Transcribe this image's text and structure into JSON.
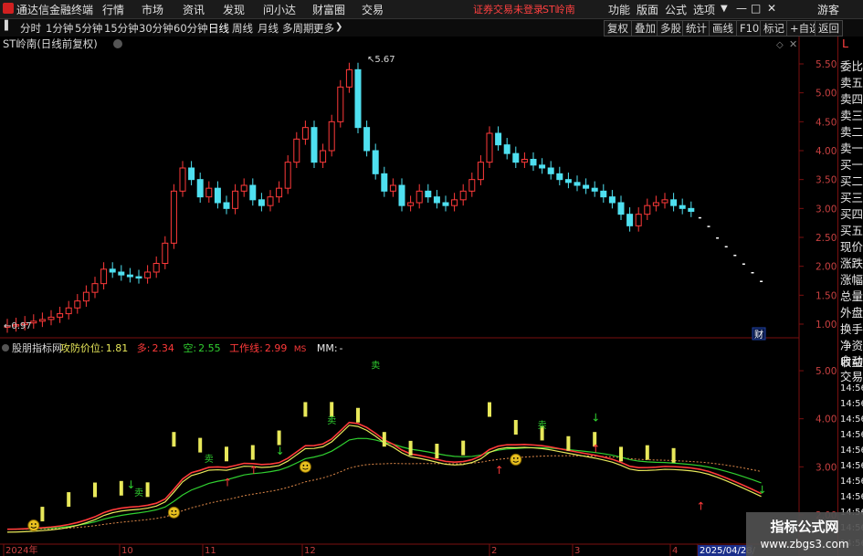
{
  "app": {
    "title": "通达信金融终端",
    "menu": [
      "行情",
      "市场",
      "资讯",
      "发现",
      "问小达",
      "财富圈",
      "交易"
    ],
    "notice": "证券交易未登录",
    "stock_tag": "ST岭南",
    "right_menu": [
      "功能",
      "版面",
      "公式",
      "选项"
    ],
    "guest": "游客"
  },
  "toolbar": {
    "timeframes": [
      "分时",
      "1分钟",
      "5分钟",
      "15分钟",
      "30分钟",
      "60分钟",
      "日线",
      "周线",
      "月线",
      "多周期",
      "更多"
    ],
    "active": "日线",
    "right_buttons": [
      "复权",
      "叠加",
      "多股",
      "统计",
      "画线",
      "F10",
      "标记",
      "+自选",
      "返回"
    ]
  },
  "main_panel": {
    "title": "ST岭南(日线前复权)",
    "price_axis": [
      "5.50",
      "5.00",
      "4.50",
      "4.00",
      "3.50",
      "3.00",
      "2.50",
      "2.00",
      "1.50",
      "1.00"
    ],
    "high_label": "5.67",
    "low_label": "0.97",
    "fin_badge": "财"
  },
  "sub_panel": {
    "name": "股朋指标网",
    "items": [
      {
        "label": "攻防价位:",
        "value": "1.81",
        "color": "#e8e85a"
      },
      {
        "label": "多:",
        "value": "2.34",
        "color": "#ff3a3a"
      },
      {
        "label": "空:",
        "value": "2.55",
        "color": "#30d030"
      },
      {
        "label": "工作线:",
        "value": "2.99",
        "color": "#ff3a3a"
      },
      {
        "label": "MS",
        "value": "",
        "color": "#ff3a3a"
      },
      {
        "label": "MM:",
        "value": "-",
        "color": "#e8e8e8"
      }
    ],
    "axis": [
      "5.00",
      "4.00",
      "3.00",
      "2.00"
    ],
    "sell_label": "卖"
  },
  "dates": [
    {
      "label": "2024年"
    },
    {
      "label": "10"
    },
    {
      "label": "11"
    },
    {
      "label": "12"
    },
    {
      "label": "2"
    },
    {
      "label": "3"
    },
    {
      "label": "4"
    },
    {
      "label": "2025/04/28/"
    }
  ],
  "right_panel": {
    "top_letter": "L",
    "labels": [
      "委比",
      "卖五",
      "卖四",
      "卖三",
      "卖二",
      "卖一",
      "买一",
      "买二",
      "买三",
      "买四",
      "买五",
      "现价",
      "涨跌",
      "涨幅",
      "总量",
      "外盘",
      "换手",
      "净资",
      "收益"
    ],
    "auto": "自动",
    "trade": "交易",
    "times": [
      "14:56",
      "14:56",
      "14:56",
      "14:56",
      "14:56",
      "14:56",
      "14:56",
      "14:56",
      "14:56",
      "14:56",
      "14:56"
    ]
  },
  "watermark": {
    "line1": "指标公式网",
    "line2": "www.zbgs3.com"
  },
  "colors": {
    "up": "#ff3a3a",
    "down": "#4fe0f0",
    "cyan_candle": "#4fe0f0",
    "yellow": "#e8e85a",
    "green": "#30d030",
    "axis": "#c84040"
  },
  "chart_data": {
    "type": "candlestick",
    "title": "ST岭南(日线前复权)",
    "y_range": [
      0.95,
      5.75
    ],
    "series": [
      {
        "name": "close",
        "values": [
          0.97,
          0.99,
          1.02,
          1.05,
          1.08,
          1.12,
          1.18,
          1.28,
          1.4,
          1.55,
          1.7,
          1.95,
          1.9,
          1.85,
          1.82,
          1.8,
          1.9,
          2.05,
          2.4,
          3.3,
          3.7,
          3.5,
          3.2,
          3.35,
          3.1,
          3.0,
          3.3,
          3.4,
          3.15,
          3.05,
          3.2,
          3.35,
          3.8,
          4.2,
          4.4,
          3.8,
          4.0,
          4.5,
          5.1,
          5.4,
          4.4,
          4.0,
          3.6,
          3.3,
          3.4,
          3.05,
          3.1,
          3.3,
          3.2,
          3.1,
          3.05,
          3.15,
          3.3,
          3.5,
          3.8,
          4.3,
          4.1,
          3.95,
          3.8,
          3.85,
          3.75,
          3.7,
          3.6,
          3.5,
          3.45,
          3.4,
          3.35,
          3.3,
          3.2,
          3.1,
          2.9,
          2.7,
          2.9,
          3.05,
          3.1,
          3.15,
          3.05,
          3.0,
          2.95,
          2.85,
          2.7,
          2.5,
          2.35,
          2.2,
          2.05,
          1.9,
          1.75
        ]
      }
    ]
  }
}
